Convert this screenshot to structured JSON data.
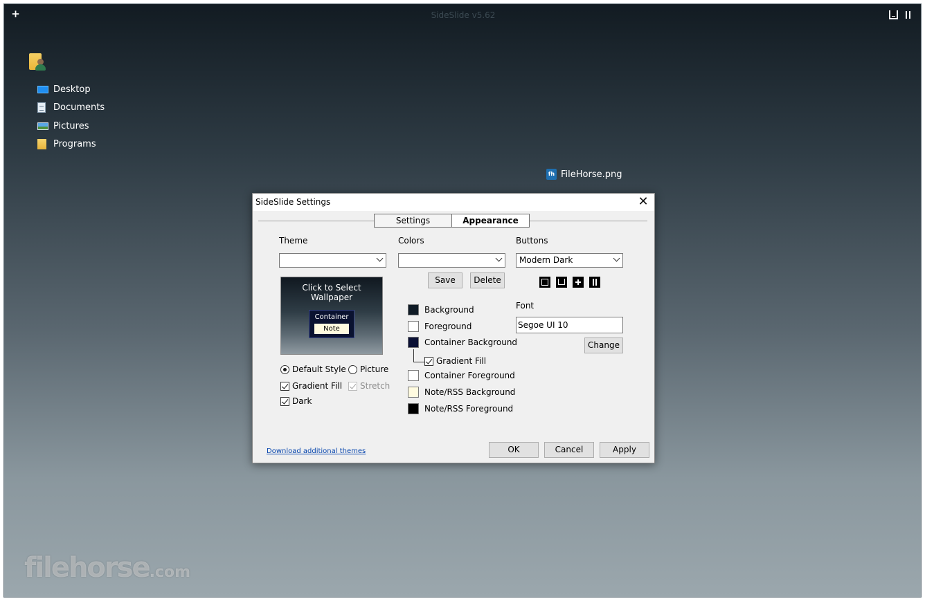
{
  "app": {
    "title": "SideSlide v5.62"
  },
  "desktop": {
    "shortcuts": [
      {
        "label": "Desktop",
        "icon": "desktop-icon"
      },
      {
        "label": "Documents",
        "icon": "documents-icon"
      },
      {
        "label": "Pictures",
        "icon": "pictures-icon"
      },
      {
        "label": "Programs",
        "icon": "folder-icon"
      }
    ],
    "file": {
      "label": "FileHorse.png"
    },
    "watermark": {
      "brand": "filehorse",
      "suffix": ".com"
    }
  },
  "dialog": {
    "title": "SideSlide Settings",
    "close_glyph": "✕",
    "tabs": [
      {
        "label": "Settings"
      },
      {
        "label": "Appearance",
        "active": true
      }
    ],
    "theme": {
      "label": "Theme",
      "value": "",
      "preview": {
        "title": "Click to Select Wallpaper",
        "container": "Container",
        "note": "Note"
      },
      "options": {
        "default_style": "Default Style",
        "picture": "Picture",
        "gradient_fill": "Gradient Fill",
        "stretch": "Stretch",
        "dark": "Dark"
      }
    },
    "colors": {
      "label": "Colors",
      "value": "",
      "save": "Save",
      "delete": "Delete",
      "items": [
        {
          "label": "Background",
          "color": "#0f1b26"
        },
        {
          "label": "Foreground",
          "color": "#ffffff"
        },
        {
          "label": "Container Background",
          "color": "#0a1035"
        },
        {
          "label": "Gradient Fill"
        },
        {
          "label": "Container Foreground",
          "color": "#ffffff"
        },
        {
          "label": "Note/RSS Background",
          "color": "#fffbe0"
        },
        {
          "label": "Note/RSS Foreground",
          "color": "#000000"
        }
      ]
    },
    "buttons": {
      "label": "Buttons",
      "value": "Modern Dark"
    },
    "font": {
      "label": "Font",
      "value": "Segoe UI 10",
      "change": "Change"
    },
    "footer": {
      "link": "Download additional themes",
      "ok": "OK",
      "cancel": "Cancel",
      "apply": "Apply"
    }
  }
}
